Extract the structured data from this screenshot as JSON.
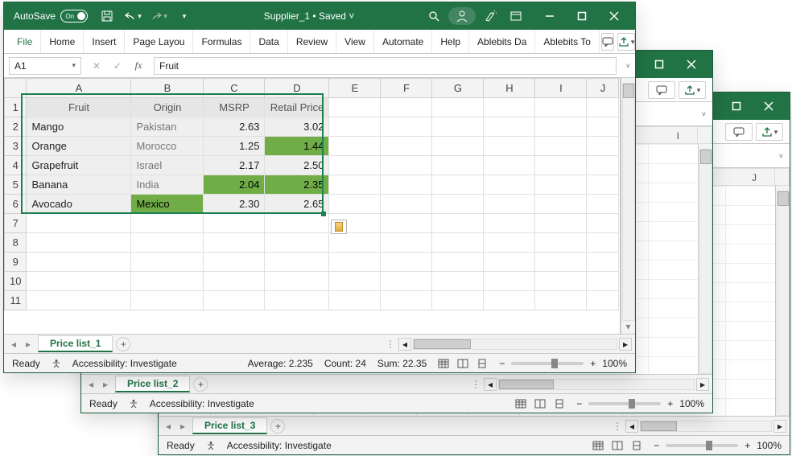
{
  "windows": {
    "win3": {
      "sheet_tab": "Price list_3",
      "status": {
        "ready": "Ready",
        "accessibility": "Accessibility: Investigate",
        "zoom": "100%"
      }
    },
    "win2": {
      "sheet_tab": "Price list_2",
      "status": {
        "ready": "Ready",
        "accessibility": "Accessibility: Investigate",
        "zoom": "100%"
      },
      "cols": [
        "I"
      ]
    },
    "win1": {
      "autosave_label": "AutoSave",
      "autosave_state": "On",
      "title": "Supplier_1 • Saved ˅",
      "tabs": [
        "File",
        "Home",
        "Insert",
        "Page Layou",
        "Formulas",
        "Data",
        "Review",
        "View",
        "Automate",
        "Help",
        "Ablebits Da",
        "Ablebits To"
      ],
      "name_box": "A1",
      "fx_value": "Fruit",
      "columns": [
        "A",
        "B",
        "C",
        "D",
        "E",
        "F",
        "G",
        "H",
        "I",
        "J"
      ],
      "row_labels": [
        "1",
        "2",
        "3",
        "4",
        "5",
        "6",
        "7",
        "8",
        "9",
        "10",
        "11"
      ],
      "headers": [
        "Fruit",
        "Origin",
        "MSRP",
        "Retail Price"
      ],
      "rows": [
        {
          "fruit": "Mango",
          "origin": "Pakistan",
          "msrp": "2.63",
          "retail": "3.02",
          "hl": []
        },
        {
          "fruit": "Orange",
          "origin": "Morocco",
          "msrp": "1.25",
          "retail": "1.44",
          "hl": [
            "retail"
          ]
        },
        {
          "fruit": "Grapefruit",
          "origin": "Israel",
          "msrp": "2.17",
          "retail": "2.50",
          "hl": []
        },
        {
          "fruit": "Banana",
          "origin": "India",
          "msrp": "2.04",
          "retail": "2.35",
          "hl": [
            "msrp",
            "retail"
          ]
        },
        {
          "fruit": "Avocado",
          "origin": "Mexico",
          "msrp": "2.30",
          "retail": "2.65",
          "hl": [
            "origin"
          ]
        }
      ],
      "sheet_tab": "Price list_1",
      "status": {
        "ready": "Ready",
        "accessibility": "Accessibility: Investigate",
        "avg_label": "Average:",
        "avg": "2.235",
        "count_label": "Count:",
        "count": "24",
        "sum_label": "Sum:",
        "sum": "22.35",
        "zoom": "100%"
      }
    }
  }
}
